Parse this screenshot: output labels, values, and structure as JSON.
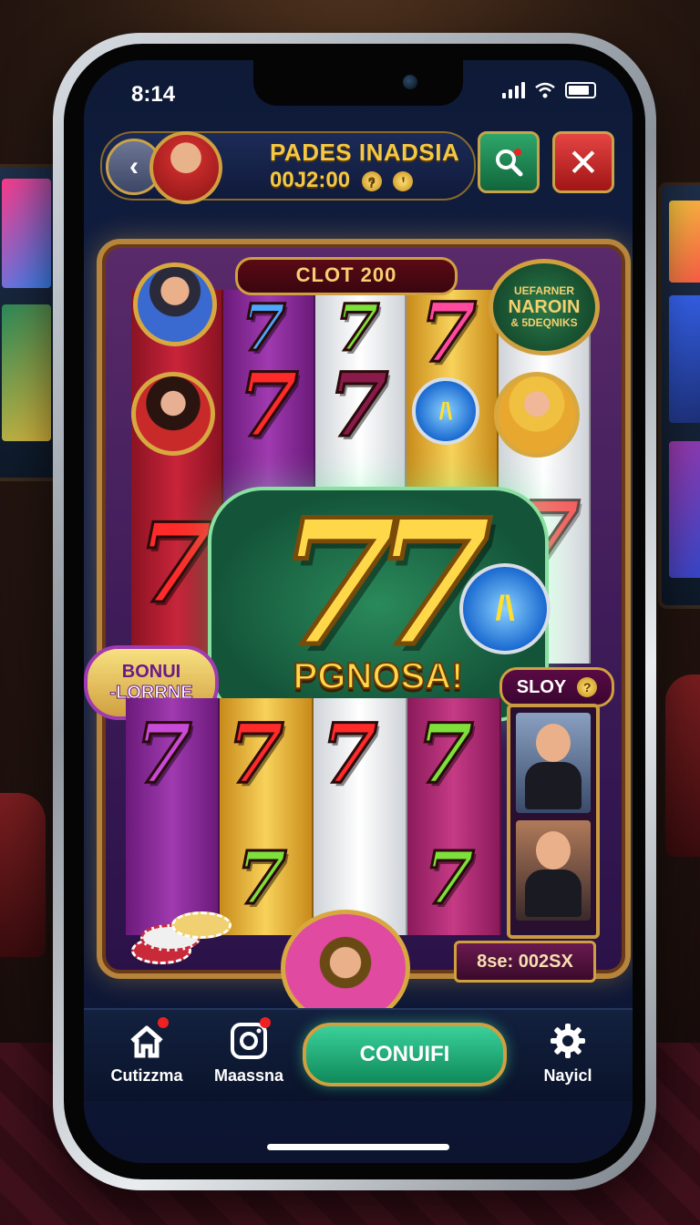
{
  "status_bar": {
    "time": "8:14"
  },
  "header": {
    "player_name": "PADES INADSIA",
    "balance": "00J2:00",
    "coin_glyphs": [
      "?",
      "ʼ"
    ],
    "back_label": "‹"
  },
  "machine": {
    "title": "CLOT 200",
    "badge": {
      "line1": "UEFARNER",
      "line2": "NAROIN",
      "line3": "& 5DEQNIKS"
    },
    "big_win": {
      "symbol": "77",
      "text": "PGNOSA!"
    },
    "bonus": {
      "line1": "BONUI",
      "line2": "-LORRNE"
    },
    "slot_label": "SLOY",
    "score": "8se: 002SX",
    "coin_mark": "/\\"
  },
  "navbar": {
    "items": [
      {
        "label": "Cutizzma",
        "icon": "home-icon"
      },
      {
        "label": "Maassna",
        "icon": "camera-icon"
      },
      {
        "label": "Nayicl",
        "icon": "gear-icon"
      }
    ],
    "confirm_label": "CONUIFI"
  },
  "colors": {
    "gold": "#d0a040",
    "green_button": "#1f9c6a",
    "red_button": "#c82222",
    "screen_bg": "#0e1a36"
  }
}
